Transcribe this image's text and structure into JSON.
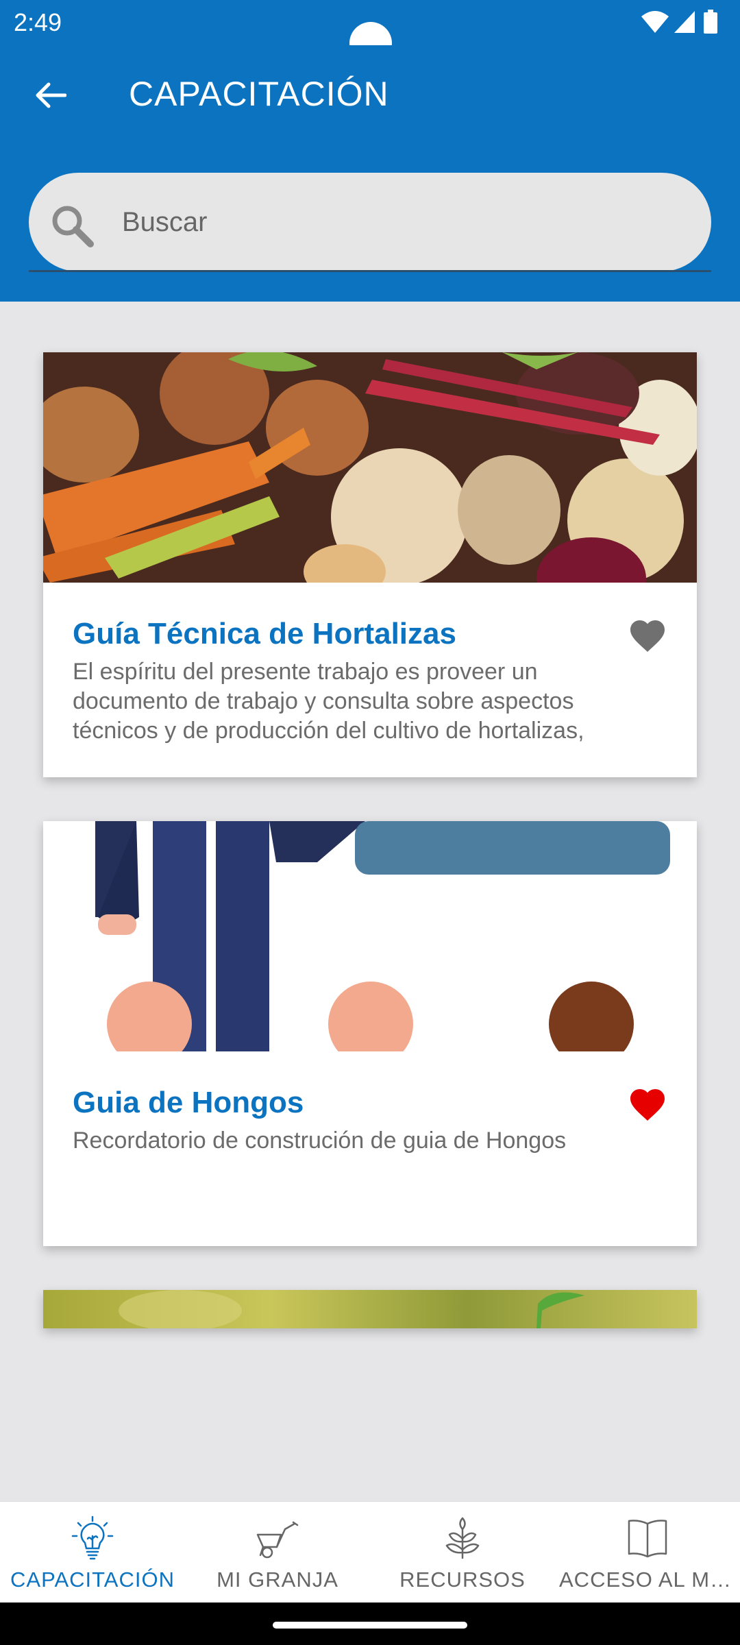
{
  "status_bar": {
    "time": "2:49",
    "icons": [
      "wifi-icon",
      "cell-signal-icon",
      "battery-icon"
    ]
  },
  "app_bar": {
    "title": "CAPACITACIÓN",
    "back_icon": "arrow-left-icon"
  },
  "search": {
    "placeholder": "Buscar",
    "icon": "search-icon"
  },
  "cards": [
    {
      "title": "Guía Técnica de Hortalizas",
      "description": "El espíritu del presente trabajo es proveer un documento de trabajo y consulta sobre aspectos técnicos y de producción del cultivo de hortalizas,",
      "favorite": false,
      "image": "vegetables-photo"
    },
    {
      "title": "Guia de Hongos",
      "description": "Recordatorio de construción de guia de Hongos",
      "favorite": true,
      "image": "people-illustration"
    },
    {
      "image": "plant-sprout-photo"
    }
  ],
  "bottom_nav": [
    {
      "label": "CAPACITACIÓN",
      "icon": "lightbulb-icon",
      "active": true
    },
    {
      "label": "MI GRANJA",
      "icon": "wheelbarrow-icon",
      "active": false
    },
    {
      "label": "RECURSOS",
      "icon": "plant-icon",
      "active": false
    },
    {
      "label": "ACCESO AL ME...",
      "icon": "open-book-icon",
      "active": false
    }
  ],
  "colors": {
    "primary": "#0b73c0",
    "favorite_on": "#e60000",
    "favorite_off": "#707070",
    "background": "#e6e6e8"
  }
}
